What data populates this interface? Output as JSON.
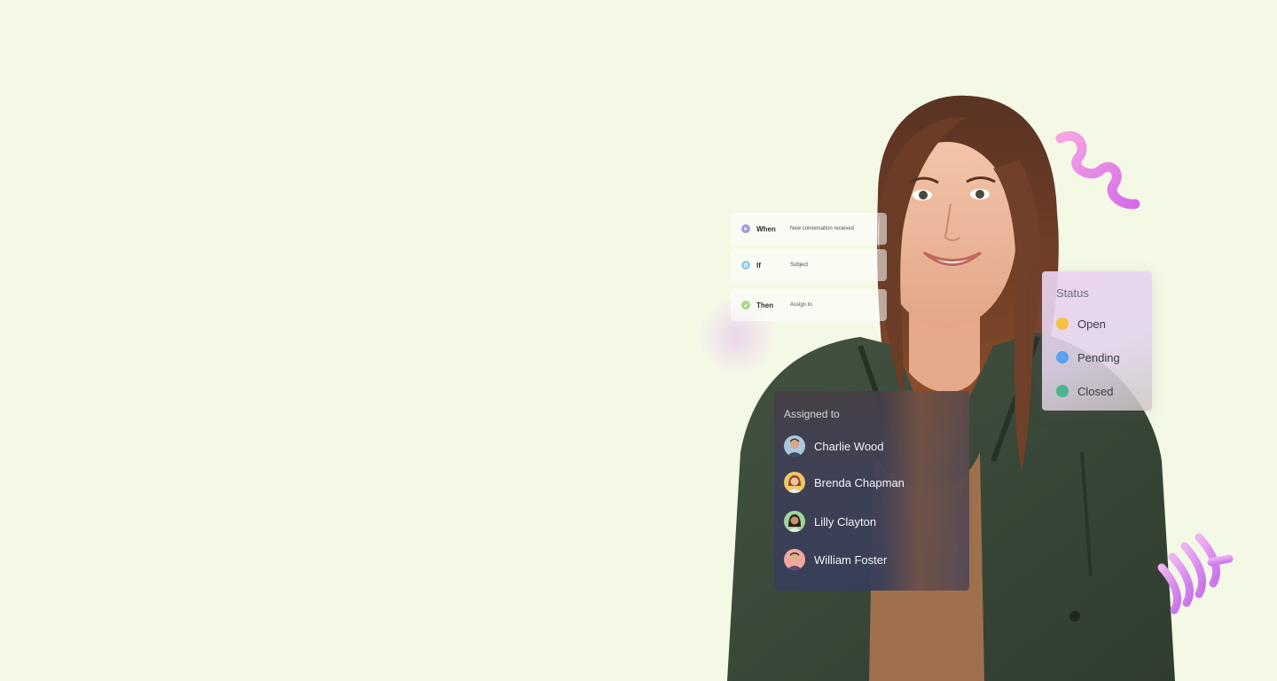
{
  "workflow": {
    "rules": [
      {
        "keyword": "When",
        "value": "New conversation recieved",
        "icon": "play-icon",
        "color": "#a99ad6"
      },
      {
        "keyword": "If",
        "value": "Subject",
        "icon": "filter-icon",
        "color": "#8fcfe6"
      },
      {
        "keyword": "Then",
        "value": "Assign to",
        "icon": "check-icon",
        "color": "#a8d68c"
      }
    ]
  },
  "status": {
    "title": "Status",
    "items": [
      {
        "label": "Open",
        "color": "#f7c144"
      },
      {
        "label": "Pending",
        "color": "#5da2f0"
      },
      {
        "label": "Closed",
        "color": "#4cb58c"
      }
    ]
  },
  "assigned": {
    "title": "Assigned to",
    "people": [
      {
        "name": "Charlie Wood"
      },
      {
        "name": "Brenda Chapman"
      },
      {
        "name": "Lilly Clayton"
      },
      {
        "name": "William Foster"
      }
    ]
  },
  "colors": {
    "page_background": "#f4f9e6",
    "jacket": "#3b4a3a",
    "shirt": "#a0704d",
    "hair": "#6b3c26",
    "decor_pink": "#e27fe6"
  }
}
